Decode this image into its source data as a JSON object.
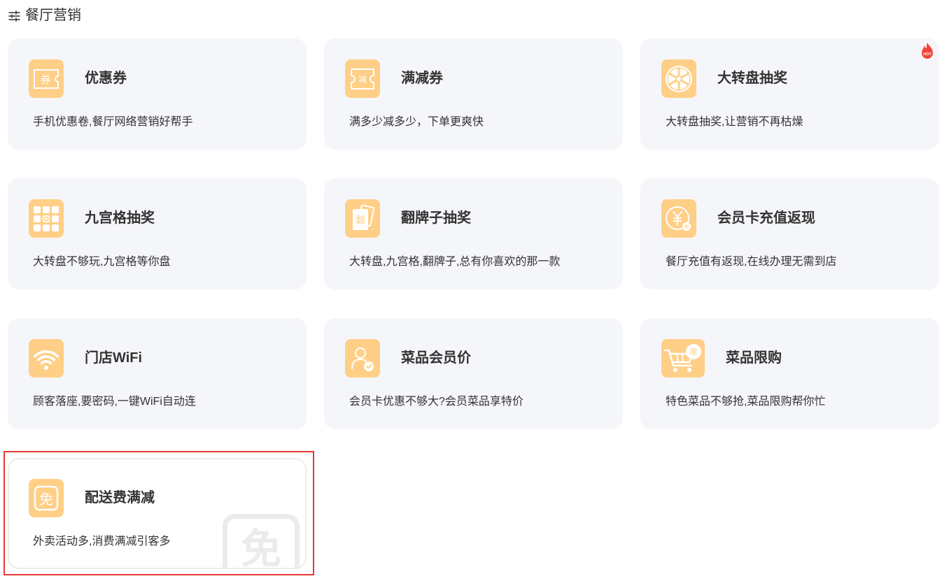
{
  "header": {
    "icon": "sliders-icon",
    "title": "餐厅营销"
  },
  "colors": {
    "icon_bg": "#ffcf87",
    "card_bg": "#f5f6fa",
    "text": "#333333",
    "highlight": "#e53935",
    "hot": "#f04438"
  },
  "cards": [
    {
      "title": "优惠券",
      "desc": "手机优惠卷,餐厅网络营销好帮手",
      "icon": "coupon-icon",
      "glyph": "券"
    },
    {
      "title": "满减券",
      "desc": "满多少减多少，下单更爽快",
      "icon": "discount-coupon-icon",
      "glyph": "减"
    },
    {
      "title": "大转盘抽奖",
      "desc": "大转盘抽奖,让营销不再枯燥",
      "icon": "prize-wheel-icon",
      "badge": "HOT"
    },
    {
      "title": "九宫格抽奖",
      "desc": "大转盘不够玩,九宫格等你盘",
      "icon": "nine-grid-icon"
    },
    {
      "title": "翻牌子抽奖",
      "desc": "大转盘,九宫格,翻牌子,总有你喜欢的那一款",
      "icon": "flip-card-icon",
      "glyph": "翻"
    },
    {
      "title": "会员卡充值返现",
      "desc": "餐厅充值有返现,在线办理无需到店",
      "icon": "recharge-cashback-icon"
    },
    {
      "title": "门店WiFi",
      "desc": "顾客落座,要密码,一键WiFi自动连",
      "icon": "wifi-icon"
    },
    {
      "title": "菜品会员价",
      "desc": "会员卡优惠不够大?会员菜品享特价",
      "icon": "member-price-icon"
    },
    {
      "title": "菜品限购",
      "desc": "特色菜品不够抢,菜品限购帮你忙",
      "icon": "cart-limit-icon",
      "glyph": "限"
    },
    {
      "title": "配送费满减",
      "desc": "外卖活动多,消费满减引客多",
      "icon": "free-delivery-icon",
      "glyph": "免",
      "highlighted": true
    }
  ]
}
